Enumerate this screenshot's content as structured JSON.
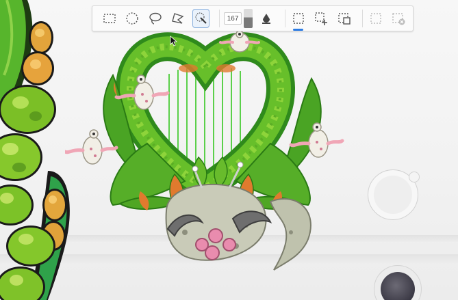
{
  "app": {
    "name": "drawing-canvas"
  },
  "toolbar": {
    "tools": [
      {
        "name": "rect-select",
        "icon": "rect-select-icon"
      },
      {
        "name": "ellipse-select",
        "icon": "ellipse-select-icon"
      },
      {
        "name": "lasso-select",
        "icon": "lasso-icon"
      },
      {
        "name": "polygon-lasso",
        "icon": "polygon-lasso-icon"
      },
      {
        "name": "magic-wand",
        "icon": "magic-wand-icon",
        "active": true
      }
    ],
    "size_value": "167",
    "fill_tool": {
      "icon": "fill-drop-icon"
    },
    "mode_buttons": [
      {
        "icon": "new-selection-icon",
        "active": true
      },
      {
        "icon": "add-selection-icon"
      },
      {
        "icon": "subtract-selection-icon"
      },
      {
        "icon": "deselect-icon",
        "disabled": true
      },
      {
        "icon": "clear-selection-icon",
        "disabled": true
      }
    ]
  },
  "colors": {
    "accent": "#2b7be4",
    "monster_green_dark": "#2e8b1e",
    "monster_green_light": "#8ccf2b",
    "monster_orange": "#e07a2e",
    "monster_body": "#c9cbb8",
    "monster_pink": "#e98cae"
  },
  "canvas_controls": {
    "round_button": {
      "icon": "round-brush-icon"
    },
    "color_button": {
      "icon": "color-swatch-icon",
      "color": "#4a4852"
    }
  }
}
